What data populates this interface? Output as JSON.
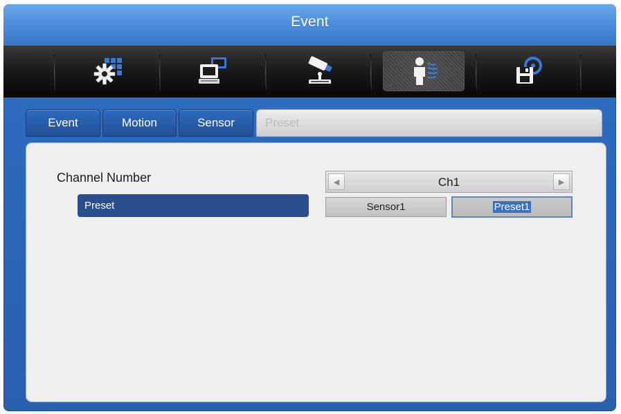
{
  "window": {
    "title": "Event"
  },
  "toolbar": {
    "icons": [
      {
        "name": "system-settings-icon",
        "active": false
      },
      {
        "name": "network-icon",
        "active": false
      },
      {
        "name": "camera-ptz-icon",
        "active": false
      },
      {
        "name": "event-person-icon",
        "active": true
      },
      {
        "name": "storage-backup-icon",
        "active": false
      }
    ]
  },
  "tabs": [
    {
      "label": "Event",
      "active": false
    },
    {
      "label": "Motion",
      "active": false
    },
    {
      "label": "Sensor",
      "active": false
    },
    {
      "label": "Preset",
      "active": true
    }
  ],
  "content": {
    "channel_label": "Channel Number",
    "channel_value": "Ch1",
    "preset_label": "Preset",
    "sensor_value": "Sensor1",
    "preset_value": "Preset1"
  },
  "colors": {
    "frame_blue": "#2a67b8",
    "selected_row": "#2a4f8f",
    "panel_bg": "#efeff0",
    "text_highlight": "#3a6fc1"
  }
}
